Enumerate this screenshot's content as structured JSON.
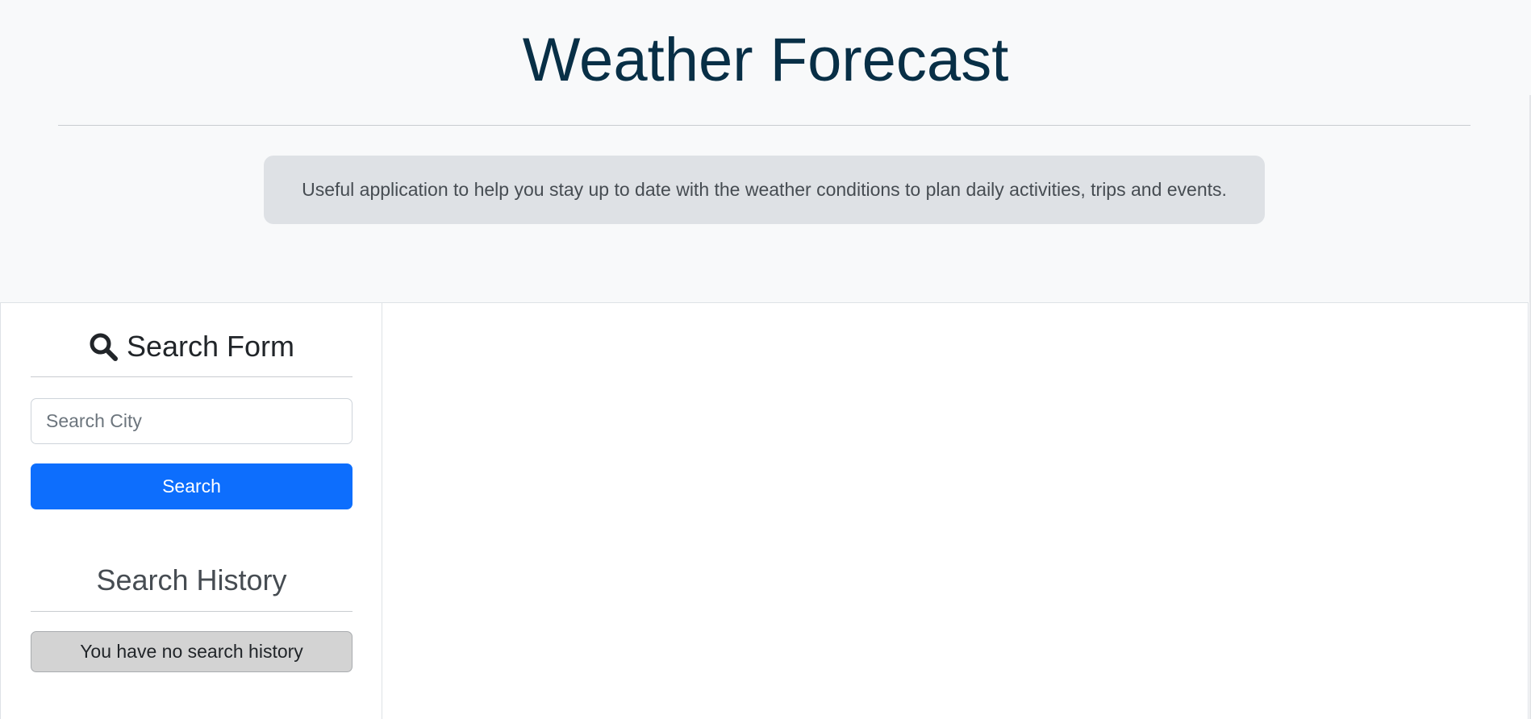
{
  "header": {
    "title": "Weather Forecast",
    "description": "Useful application to help you stay up to date with the weather conditions to plan daily activities, trips and events."
  },
  "search_form": {
    "icon": "search-icon",
    "title": "Search Form",
    "input_placeholder": "Search City",
    "input_value": "",
    "button_label": "Search"
  },
  "search_history": {
    "title": "Search History",
    "empty_message": "You have no search history"
  },
  "colors": {
    "header_background": "#f8f9fa",
    "title_color": "#082f46",
    "description_background": "#dee1e5",
    "primary_button": "#0d6efd",
    "history_item_background": "#d3d3d3"
  }
}
